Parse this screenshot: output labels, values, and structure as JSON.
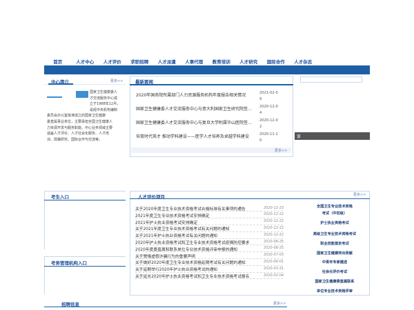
{
  "nav": {
    "items": [
      "首页",
      "人才中心",
      "人才评价",
      "求职招聘",
      "人才派遣",
      "人事代理",
      "教育培训",
      "人才研究",
      "国际合作",
      "人才杂志"
    ]
  },
  "center_intro": {
    "title": "中心简介",
    "more": "更多>>",
    "text": "国家卫生健康委人才交流服务中心成立于1988年12月，是经中央机构编制委员会办公室批准成立的国家卫生健康委直属事业单位，主要承担全国卫生健康人力资源开发与服务职能。中心业务领域主要涵盖人才评价、人才社会化服务、人才培训、政策研究、国际合作与交流等。",
    "text_lines": [
      "国家卫生健康委人",
      "才交流服务中心成",
      "立于1988年12月，",
      "是经中央机构编制",
      "委员会办公室批准成立的国家卫生健康",
      "委直属事业单位，主要承担全国卫生健康人",
      "力资源开发与服务职能。中心业务领域主要",
      "涵盖人才评价、人才社会化服务、人才培",
      "训、政策研究、国际合作与交流等。"
    ]
  },
  "news": {
    "title": "最新要闻",
    "more": "更多>>",
    "items": [
      {
        "title": "2020年国务院所属部门人力资源服务机构年度报告相关情况",
        "date_a": "2021-02-0",
        "date_b": "9"
      },
      {
        "title": "国家卫生健康委人才交流服务中心与意大利国家卫生研究院签署合作备忘录",
        "date_a": "2020-12-0",
        "date_b": "4"
      },
      {
        "title": "国家卫生健康委人才交流服务中心与复旦大学附属华山医院签署合作协议",
        "date_a": "2020-12-0",
        "date_b": "2"
      },
      {
        "title": "培育时代英才 推动学科建设——医学人才培养及卓越学科建设",
        "date_a": "2020-11-1",
        "date_b": "0"
      }
    ],
    "image_caption": "谋"
  },
  "exam_entry": {
    "title": "考生入口"
  },
  "exam_org_entry": {
    "title": "考务管理机构入口"
  },
  "evaluation": {
    "title": "人才评价项目",
    "more": "更多>>",
    "items": [
      {
        "title": "关于2020年度卫生专业技术资格考试合格标准有关事项的通告",
        "date": "2020-12-23"
      },
      {
        "title": "2021年度卫生专业技术资格考试安排确定",
        "date": "2020-12-22"
      },
      {
        "title": "2021年护士执业资格考试安排确定",
        "date": "2020-12-22"
      },
      {
        "title": "关于2021年度卫生专业技术资格考试有关问题的通知",
        "date": "2020-12-22"
      },
      {
        "title": "关于2021年护士执业资格考试有关问题的通知",
        "date": "2020-12-22"
      },
      {
        "title": "2020年护士执业资格考试和卫生专业技术资格考试疫情防控要求",
        "date": "2020-08-25"
      },
      {
        "title": "2020年度委直属和联系单位专业技术资格评审申报的通知",
        "date": "2020-08-25"
      },
      {
        "title": "关于警惕虚假诈骗行为的重要声明",
        "date": "2020-07-03"
      },
      {
        "title": "关于做好2020年度卫生专业技术资格延期考试有关问题的通知",
        "date": "2020-06-01"
      },
      {
        "title": "关于延期举行2020年护士执业资格考试的通知",
        "date": "2020-03-31"
      },
      {
        "title": "关于延长2020年护士执业资格考试和卫生专业技术资格考试报名",
        "date": "2020-02-04"
      }
    ]
  },
  "projects": {
    "items": [
      "全国卫生专业技术资格",
      "考试（中初级）",
      "护士执业资格考试",
      "高级卫生专业技术资格考试",
      "职业技能鉴定考试",
      "国家卫生健康突出贡献",
      "中青年专家遴选",
      "社会化评价考试",
      "国家卫生健康委直属联系",
      "单位专业技术资格评审"
    ]
  },
  "recruit": {
    "title": "招聘信息",
    "more": "更多>>"
  },
  "colors": {
    "brand_blue": "#1c5fa6",
    "title_blue": "#1b4f9c",
    "panel_border": "#c8d7ea"
  }
}
